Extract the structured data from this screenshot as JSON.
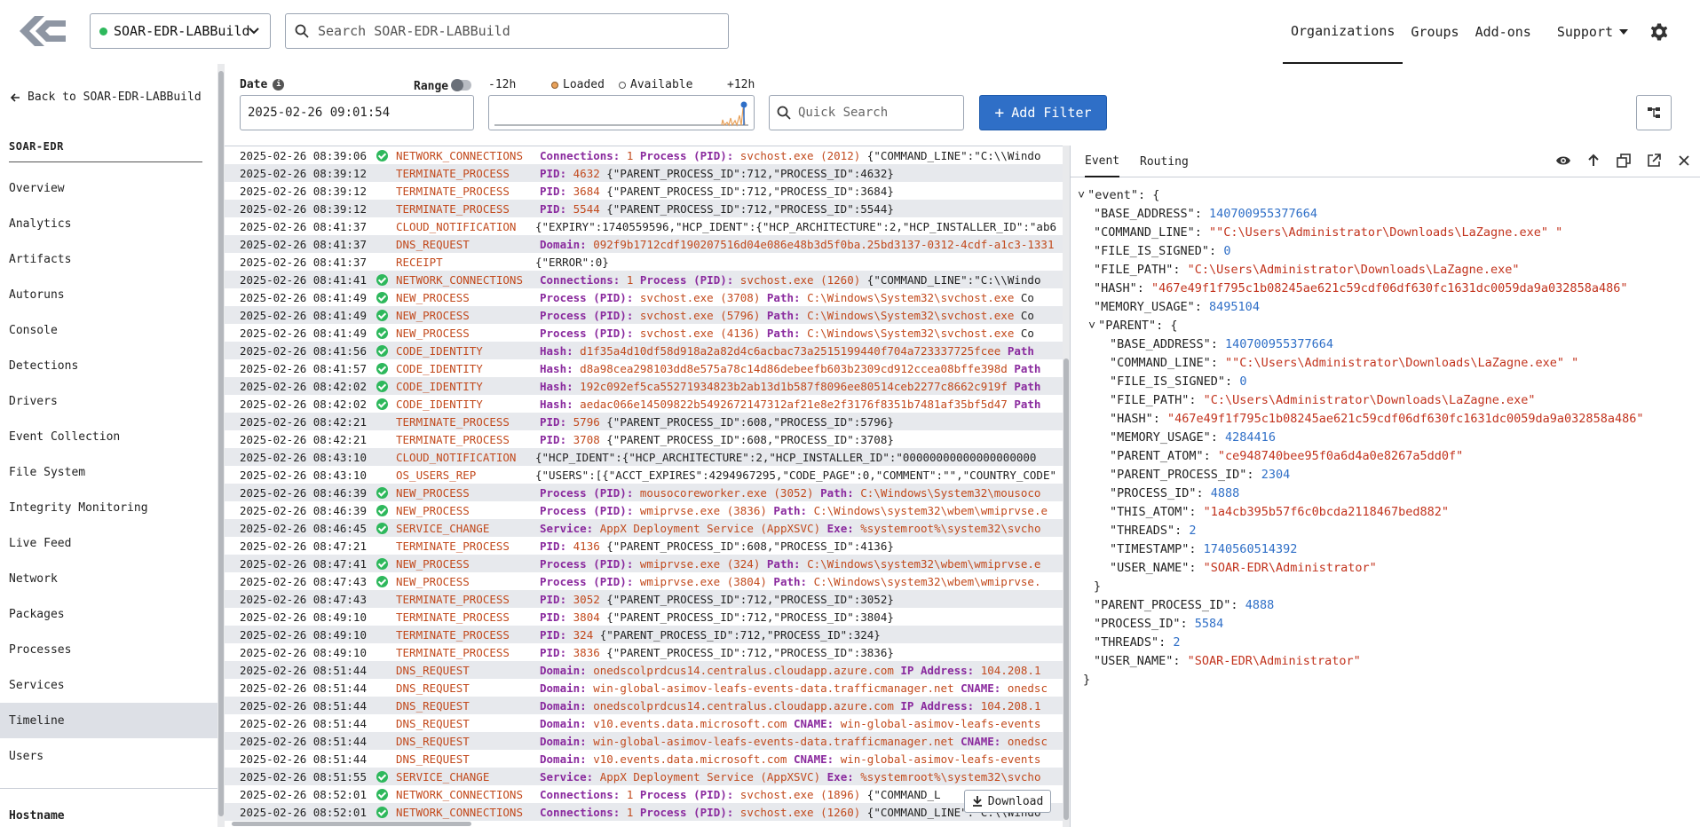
{
  "header": {
    "sensor": "SOAR-EDR-LABBuild",
    "search_placeholder": "Search SOAR-EDR-LABBuild",
    "nav": [
      "Organizations",
      "Groups",
      "Add-ons",
      "Support"
    ]
  },
  "sidebar": {
    "back": "Back to SOAR-EDR-LABBuild",
    "org": "SOAR-EDR",
    "items": [
      "Overview",
      "Analytics",
      "Artifacts",
      "Autoruns",
      "Console",
      "Detections",
      "Drivers",
      "Event Collection",
      "File System",
      "Integrity Monitoring",
      "Live Feed",
      "Network",
      "Packages",
      "Processes",
      "Services",
      "Timeline",
      "Users"
    ],
    "selected": "Timeline",
    "hostname_label": "Hostname"
  },
  "toolbar": {
    "date_label": "Date",
    "range_label": "Range",
    "date_value": "2025-02-26 09:01:54",
    "minus": "-12h",
    "loaded": "Loaded",
    "available": "Available",
    "plus": "+12h",
    "quick_search_placeholder": "Quick Search",
    "add_filter": "Add Filter"
  },
  "colors": {
    "accent": "#2f6fc7",
    "type": "#c24a1d",
    "field": "#8a2a9e",
    "ok": "#2eb85c"
  },
  "timeline": [
    {
      "ts": "2025-02-26 08:39:06",
      "ok": true,
      "type": "NETWORK_CONNECTIONS",
      "f1": "Connections:",
      "v1": "1",
      "f2": "Process (PID):",
      "v2": "svchost.exe (2012)",
      "rest": "{\"COMMAND_LINE\":\"C:\\\\Windo"
    },
    {
      "ts": "2025-02-26 08:39:12",
      "ok": false,
      "type": "TERMINATE_PROCESS",
      "f1": "PID:",
      "v1": "4632",
      "f2": "",
      "v2": "",
      "rest": "{\"PARENT_PROCESS_ID\":712,\"PROCESS_ID\":4632}"
    },
    {
      "ts": "2025-02-26 08:39:12",
      "ok": false,
      "type": "TERMINATE_PROCESS",
      "f1": "PID:",
      "v1": "3684",
      "f2": "",
      "v2": "",
      "rest": "{\"PARENT_PROCESS_ID\":712,\"PROCESS_ID\":3684}"
    },
    {
      "ts": "2025-02-26 08:39:12",
      "ok": false,
      "type": "TERMINATE_PROCESS",
      "f1": "PID:",
      "v1": "5544",
      "f2": "",
      "v2": "",
      "rest": "{\"PARENT_PROCESS_ID\":712,\"PROCESS_ID\":5544}"
    },
    {
      "ts": "2025-02-26 08:41:37",
      "ok": false,
      "type": "CLOUD_NOTIFICATION",
      "f1": "",
      "v1": "",
      "f2": "",
      "v2": "",
      "rest": "{\"EXPIRY\":1740559596,\"HCP_IDENT\":{\"HCP_ARCHITECTURE\":2,\"HCP_INSTALLER_ID\":\"ab6"
    },
    {
      "ts": "2025-02-26 08:41:37",
      "ok": false,
      "type": "DNS_REQUEST",
      "f1": "Domain:",
      "v1": "092f9b1712cdf190207516d04e086e48b3d5f0ba.25bd3137-0312-4cdf-a1c3-1331",
      "f2": "",
      "v2": "",
      "rest": ""
    },
    {
      "ts": "2025-02-26 08:41:37",
      "ok": false,
      "type": "RECEIPT",
      "f1": "",
      "v1": "",
      "f2": "",
      "v2": "",
      "rest": "{\"ERROR\":0}"
    },
    {
      "ts": "2025-02-26 08:41:41",
      "ok": true,
      "type": "NETWORK_CONNECTIONS",
      "f1": "Connections:",
      "v1": "1",
      "f2": "Process (PID):",
      "v2": "svchost.exe (1260)",
      "rest": "{\"COMMAND_LINE\":\"C:\\\\Windo"
    },
    {
      "ts": "2025-02-26 08:41:49",
      "ok": true,
      "type": "NEW_PROCESS",
      "f1": "Process (PID):",
      "v1": "svchost.exe (3708)",
      "f2": "Path:",
      "v2": "C:\\Windows\\System32\\svchost.exe",
      "rest": "Co"
    },
    {
      "ts": "2025-02-26 08:41:49",
      "ok": true,
      "type": "NEW_PROCESS",
      "f1": "Process (PID):",
      "v1": "svchost.exe (5796)",
      "f2": "Path:",
      "v2": "C:\\Windows\\System32\\svchost.exe",
      "rest": "Co"
    },
    {
      "ts": "2025-02-26 08:41:49",
      "ok": true,
      "type": "NEW_PROCESS",
      "f1": "Process (PID):",
      "v1": "svchost.exe (4136)",
      "f2": "Path:",
      "v2": "C:\\Windows\\System32\\svchost.exe",
      "rest": "Co"
    },
    {
      "ts": "2025-02-26 08:41:56",
      "ok": true,
      "type": "CODE_IDENTITY",
      "f1": "Hash:",
      "v1": "d1f35a4d10df58d918a2a82d4c6acbac73a2515199440f704a723337725fcee",
      "f2": "Path",
      "v2": "",
      "rest": ""
    },
    {
      "ts": "2025-02-26 08:41:57",
      "ok": true,
      "type": "CODE_IDENTITY",
      "f1": "Hash:",
      "v1": "d8a98cea298103dd8e575a78c14d86debeefb603b2309cd912ccea08bffe398d",
      "f2": "Path",
      "v2": "",
      "rest": ""
    },
    {
      "ts": "2025-02-26 08:42:02",
      "ok": true,
      "type": "CODE_IDENTITY",
      "f1": "Hash:",
      "v1": "192c092ef5ca55271934823b2ab13d1b587f8096ee80514ceb2277c8662c919f",
      "f2": "Path",
      "v2": "",
      "rest": ""
    },
    {
      "ts": "2025-02-26 08:42:02",
      "ok": true,
      "type": "CODE_IDENTITY",
      "f1": "Hash:",
      "v1": "aedac066e14509822b5492672147312af21e8e2f3176f8351b7481af35bf5d47",
      "f2": "Path",
      "v2": "",
      "rest": ""
    },
    {
      "ts": "2025-02-26 08:42:21",
      "ok": false,
      "type": "TERMINATE_PROCESS",
      "f1": "PID:",
      "v1": "5796",
      "f2": "",
      "v2": "",
      "rest": "{\"PARENT_PROCESS_ID\":608,\"PROCESS_ID\":5796}"
    },
    {
      "ts": "2025-02-26 08:42:21",
      "ok": false,
      "type": "TERMINATE_PROCESS",
      "f1": "PID:",
      "v1": "3708",
      "f2": "",
      "v2": "",
      "rest": "{\"PARENT_PROCESS_ID\":608,\"PROCESS_ID\":3708}"
    },
    {
      "ts": "2025-02-26 08:43:10",
      "ok": false,
      "type": "CLOUD_NOTIFICATION",
      "f1": "",
      "v1": "",
      "f2": "",
      "v2": "",
      "rest": "{\"HCP_IDENT\":{\"HCP_ARCHITECTURE\":2,\"HCP_INSTALLER_ID\":\"00000000000000000000"
    },
    {
      "ts": "2025-02-26 08:43:10",
      "ok": false,
      "type": "OS_USERS_REP",
      "f1": "",
      "v1": "",
      "f2": "",
      "v2": "",
      "rest": "{\"USERS\":[{\"ACCT_EXPIRES\":4294967295,\"CODE_PAGE\":0,\"COMMENT\":\"\",\"COUNTRY_CODE\""
    },
    {
      "ts": "2025-02-26 08:46:39",
      "ok": true,
      "type": "NEW_PROCESS",
      "f1": "Process (PID):",
      "v1": "mousocoreworker.exe (3052)",
      "f2": "Path:",
      "v2": "C:\\Windows\\System32\\mousoco",
      "rest": ""
    },
    {
      "ts": "2025-02-26 08:46:39",
      "ok": true,
      "type": "NEW_PROCESS",
      "f1": "Process (PID):",
      "v1": "wmiprvse.exe (3836)",
      "f2": "Path:",
      "v2": "C:\\Windows\\system32\\wbem\\wmiprvse.e",
      "rest": ""
    },
    {
      "ts": "2025-02-26 08:46:45",
      "ok": true,
      "type": "SERVICE_CHANGE",
      "f1": "Service:",
      "v1": "AppX Deployment Service (AppXSVC)",
      "f2": "Exe:",
      "v2": "%systemroot%\\system32\\svcho",
      "rest": ""
    },
    {
      "ts": "2025-02-26 08:47:21",
      "ok": false,
      "type": "TERMINATE_PROCESS",
      "f1": "PID:",
      "v1": "4136",
      "f2": "",
      "v2": "",
      "rest": "{\"PARENT_PROCESS_ID\":608,\"PROCESS_ID\":4136}"
    },
    {
      "ts": "2025-02-26 08:47:41",
      "ok": true,
      "type": "NEW_PROCESS",
      "f1": "Process (PID):",
      "v1": "wmiprvse.exe (324)",
      "f2": "Path:",
      "v2": "C:\\Windows\\system32\\wbem\\wmiprvse.e",
      "rest": ""
    },
    {
      "ts": "2025-02-26 08:47:43",
      "ok": true,
      "type": "NEW_PROCESS",
      "f1": "Process (PID):",
      "v1": "wmiprvse.exe (3804)",
      "f2": "Path:",
      "v2": "C:\\Windows\\system32\\wbem\\wmiprvse.",
      "rest": ""
    },
    {
      "ts": "2025-02-26 08:47:43",
      "ok": false,
      "type": "TERMINATE_PROCESS",
      "f1": "PID:",
      "v1": "3052",
      "f2": "",
      "v2": "",
      "rest": "{\"PARENT_PROCESS_ID\":712,\"PROCESS_ID\":3052}"
    },
    {
      "ts": "2025-02-26 08:49:10",
      "ok": false,
      "type": "TERMINATE_PROCESS",
      "f1": "PID:",
      "v1": "3804",
      "f2": "",
      "v2": "",
      "rest": "{\"PARENT_PROCESS_ID\":712,\"PROCESS_ID\":3804}"
    },
    {
      "ts": "2025-02-26 08:49:10",
      "ok": false,
      "type": "TERMINATE_PROCESS",
      "f1": "PID:",
      "v1": "324",
      "f2": "",
      "v2": "",
      "rest": "{\"PARENT_PROCESS_ID\":712,\"PROCESS_ID\":324}"
    },
    {
      "ts": "2025-02-26 08:49:10",
      "ok": false,
      "type": "TERMINATE_PROCESS",
      "f1": "PID:",
      "v1": "3836",
      "f2": "",
      "v2": "",
      "rest": "{\"PARENT_PROCESS_ID\":712,\"PROCESS_ID\":3836}"
    },
    {
      "ts": "2025-02-26 08:51:44",
      "ok": false,
      "type": "DNS_REQUEST",
      "f1": "Domain:",
      "v1": "onedscolprdcus14.centralus.cloudapp.azure.com",
      "f2": "IP Address:",
      "v2": "104.208.1",
      "rest": ""
    },
    {
      "ts": "2025-02-26 08:51:44",
      "ok": false,
      "type": "DNS_REQUEST",
      "f1": "Domain:",
      "v1": "win-global-asimov-leafs-events-data.trafficmanager.net",
      "f2": "CNAME:",
      "v2": "onedsc",
      "rest": ""
    },
    {
      "ts": "2025-02-26 08:51:44",
      "ok": false,
      "type": "DNS_REQUEST",
      "f1": "Domain:",
      "v1": "onedscolprdcus14.centralus.cloudapp.azure.com",
      "f2": "IP Address:",
      "v2": "104.208.1",
      "rest": ""
    },
    {
      "ts": "2025-02-26 08:51:44",
      "ok": false,
      "type": "DNS_REQUEST",
      "f1": "Domain:",
      "v1": "v10.events.data.microsoft.com",
      "f2": "CNAME:",
      "v2": "win-global-asimov-leafs-events",
      "rest": ""
    },
    {
      "ts": "2025-02-26 08:51:44",
      "ok": false,
      "type": "DNS_REQUEST",
      "f1": "Domain:",
      "v1": "win-global-asimov-leafs-events-data.trafficmanager.net",
      "f2": "CNAME:",
      "v2": "onedsc",
      "rest": ""
    },
    {
      "ts": "2025-02-26 08:51:44",
      "ok": false,
      "type": "DNS_REQUEST",
      "f1": "Domain:",
      "v1": "v10.events.data.microsoft.com",
      "f2": "CNAME:",
      "v2": "win-global-asimov-leafs-events",
      "rest": ""
    },
    {
      "ts": "2025-02-26 08:51:55",
      "ok": true,
      "type": "SERVICE_CHANGE",
      "f1": "Service:",
      "v1": "AppX Deployment Service (AppXSVC)",
      "f2": "Exe:",
      "v2": "%systemroot%\\system32\\svcho",
      "rest": ""
    },
    {
      "ts": "2025-02-26 08:52:01",
      "ok": true,
      "type": "NETWORK_CONNECTIONS",
      "f1": "Connections:",
      "v1": "1",
      "f2": "Process (PID):",
      "v2": "svchost.exe (1896)",
      "rest": "{\"COMMAND_L"
    },
    {
      "ts": "2025-02-26 08:52:01",
      "ok": true,
      "type": "NETWORK_CONNECTIONS",
      "f1": "Connections:",
      "v1": "1",
      "f2": "Process (PID):",
      "v2": "svchost.exe (1260)",
      "rest": "{\"COMMAND_LINE\":\"C:\\\\Windo"
    }
  ],
  "download_label": "Download",
  "panel": {
    "tabs": [
      "Event",
      "Routing"
    ],
    "json_lines": [
      {
        "i": 0,
        "t": "\"event\": {",
        "k": "",
        "v": "",
        "c": "p",
        "tog": true
      },
      {
        "i": 1,
        "k": "\"BASE_ADDRESS\": ",
        "v": "140700955377664",
        "c": "n"
      },
      {
        "i": 1,
        "k": "\"COMMAND_LINE\": ",
        "v": "\"\"C:\\Users\\Administrator\\Downloads\\LaZagne.exe\" \"",
        "c": "s"
      },
      {
        "i": 1,
        "k": "\"FILE_IS_SIGNED\": ",
        "v": "0",
        "c": "n"
      },
      {
        "i": 1,
        "k": "\"FILE_PATH\": ",
        "v": "\"C:\\Users\\Administrator\\Downloads\\LaZagne.exe\"",
        "c": "s"
      },
      {
        "i": 1,
        "k": "\"HASH\": ",
        "v": "\"467e49f1f795c1b08245ae621c59cdf06df630fc1631dc0059da9a032858a486\"",
        "c": "s"
      },
      {
        "i": 1,
        "k": "\"MEMORY_USAGE\": ",
        "v": "8495104",
        "c": "n"
      },
      {
        "i": 1,
        "t": "\"PARENT\": {",
        "k": "",
        "v": "",
        "c": "p",
        "tog": true
      },
      {
        "i": 2,
        "k": "\"BASE_ADDRESS\": ",
        "v": "140700955377664",
        "c": "n"
      },
      {
        "i": 2,
        "k": "\"COMMAND_LINE\": ",
        "v": "\"\"C:\\Users\\Administrator\\Downloads\\LaZagne.exe\" \"",
        "c": "s"
      },
      {
        "i": 2,
        "k": "\"FILE_IS_SIGNED\": ",
        "v": "0",
        "c": "n"
      },
      {
        "i": 2,
        "k": "\"FILE_PATH\": ",
        "v": "\"C:\\Users\\Administrator\\Downloads\\LaZagne.exe\"",
        "c": "s"
      },
      {
        "i": 2,
        "k": "\"HASH\": ",
        "v": "\"467e49f1f795c1b08245ae621c59cdf06df630fc1631dc0059da9a032858a486\"",
        "c": "s"
      },
      {
        "i": 2,
        "k": "\"MEMORY_USAGE\": ",
        "v": "4284416",
        "c": "n"
      },
      {
        "i": 2,
        "k": "\"PARENT_ATOM\": ",
        "v": "\"ce948740bee95f0a6d4a0e8267a5dd0f\"",
        "c": "s"
      },
      {
        "i": 2,
        "k": "\"PARENT_PROCESS_ID\": ",
        "v": "2304",
        "c": "n"
      },
      {
        "i": 2,
        "k": "\"PROCESS_ID\": ",
        "v": "4888",
        "c": "n"
      },
      {
        "i": 2,
        "k": "\"THIS_ATOM\": ",
        "v": "\"1a4cb395b57f6c0bcda2118467bed882\"",
        "c": "s"
      },
      {
        "i": 2,
        "k": "\"THREADS\": ",
        "v": "2",
        "c": "n"
      },
      {
        "i": 2,
        "k": "\"TIMESTAMP\": ",
        "v": "1740560514392",
        "c": "n"
      },
      {
        "i": 2,
        "k": "\"USER_NAME\": ",
        "v": "\"SOAR-EDR\\Administrator\"",
        "c": "s"
      },
      {
        "i": 1,
        "t": "}",
        "k": "",
        "v": "",
        "c": "p"
      },
      {
        "i": 1,
        "k": "\"PARENT_PROCESS_ID\": ",
        "v": "4888",
        "c": "n"
      },
      {
        "i": 1,
        "k": "\"PROCESS_ID\": ",
        "v": "5584",
        "c": "n"
      },
      {
        "i": 1,
        "k": "\"THREADS\": ",
        "v": "2",
        "c": "n"
      },
      {
        "i": 1,
        "k": "\"USER_NAME\": ",
        "v": "\"SOAR-EDR\\Administrator\"",
        "c": "s"
      },
      {
        "i": 0,
        "t": "}",
        "k": "",
        "v": "",
        "c": "p"
      }
    ]
  }
}
